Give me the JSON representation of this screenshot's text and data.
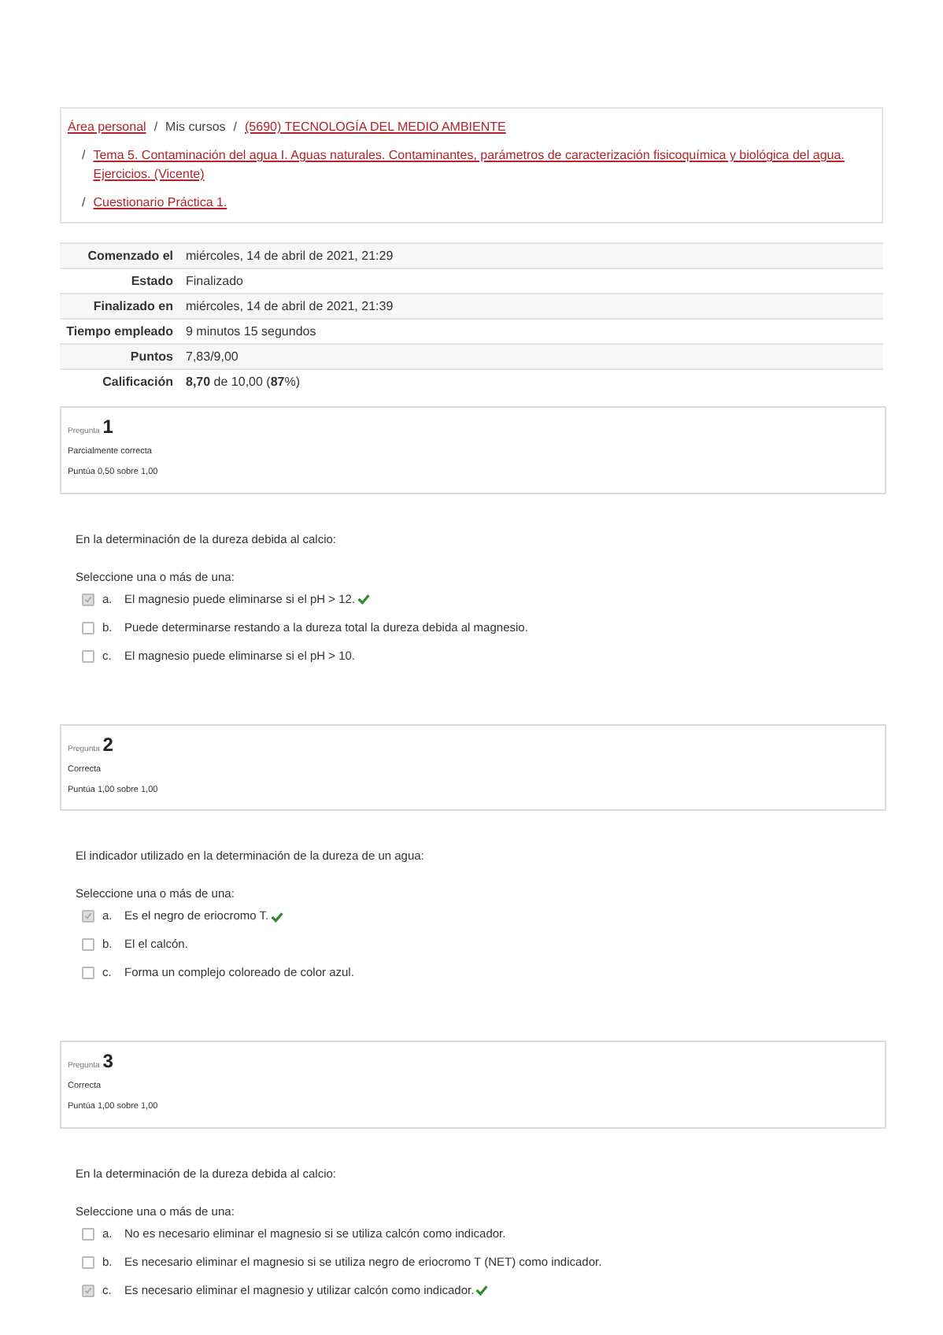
{
  "breadcrumb": {
    "lines": [
      {
        "items": [
          {
            "kind": "link",
            "text": "Área personal"
          },
          {
            "kind": "separator",
            "text": "/"
          },
          {
            "kind": "text",
            "text": "Mis cursos"
          },
          {
            "kind": "separator",
            "text": "/"
          },
          {
            "kind": "link",
            "text": "(5690) TECNOLOGÍA DEL MEDIO AMBIENTE"
          }
        ]
      },
      {
        "items": [
          {
            "kind": "separator",
            "text": "/"
          },
          {
            "kind": "link",
            "text": "Tema 5. Contaminación del agua I. Aguas naturales. Contaminantes, parámetros de caracterización fisicoquímica y biológica del agua. Ejercicios. (Vicente)"
          }
        ]
      },
      {
        "items": [
          {
            "kind": "separator",
            "text": "/"
          },
          {
            "kind": "link",
            "text": "Cuestionario Práctica 1."
          }
        ]
      }
    ]
  },
  "summary": [
    {
      "label": "Comenzado el",
      "value": "miércoles, 14 de abril de 2021, 21:29"
    },
    {
      "label": "Estado",
      "value": "Finalizado"
    },
    {
      "label": "Finalizado en",
      "value": "miércoles, 14 de abril de 2021, 21:39"
    },
    {
      "label": "Tiempo empleado",
      "value": "9 minutos 15 segundos"
    },
    {
      "label": "Puntos",
      "value": "7,83/9,00"
    },
    {
      "label": "Calificación",
      "value": "**8,70** de 10,00 (**87**%)"
    }
  ],
  "questions": [
    {
      "prefix": "Pregunta",
      "number": "1",
      "status": "Parcialmente correcta",
      "score": "Puntúa 0,50 sobre 1,00",
      "text": "En la determinación de la dureza debida al calcio:",
      "prompt": "Seleccione una o más de una:",
      "options": [
        {
          "letter": "a.",
          "text": "El magnesio puede eliminarse si el pH > 12.",
          "checked": true,
          "correct": true
        },
        {
          "letter": "b.",
          "text": "Puede determinarse restando a la dureza total la dureza debida al magnesio.",
          "checked": false,
          "correct": false
        },
        {
          "letter": "c.",
          "text": "El magnesio puede eliminarse si el pH > 10.",
          "checked": false,
          "correct": false
        }
      ]
    },
    {
      "prefix": "Pregunta",
      "number": "2",
      "status": "Correcta",
      "score": "Puntúa 1,00 sobre 1,00",
      "text": "El indicador utilizado en la determinación de la dureza de un agua:",
      "prompt": "Seleccione una o más de una:",
      "options": [
        {
          "letter": "a.",
          "text": "Es el negro de eriocromo T.",
          "checked": true,
          "correct": true
        },
        {
          "letter": "b.",
          "text": "El el calcón.",
          "checked": false,
          "correct": false
        },
        {
          "letter": "c.",
          "text": "Forma un complejo coloreado de color azul.",
          "checked": false,
          "correct": false
        }
      ]
    },
    {
      "prefix": "Pregunta",
      "number": "3",
      "status": "Correcta",
      "score": "Puntúa 1,00 sobre 1,00",
      "text": "En la determinación de la dureza debida al calcio:",
      "prompt": "Seleccione una o más de una:",
      "options": [
        {
          "letter": "a.",
          "text": "No es necesario eliminar el magnesio si se utiliza calcón como indicador.",
          "checked": false,
          "correct": false
        },
        {
          "letter": "b.",
          "text": "Es necesario eliminar el magnesio si se utiliza negro de eriocromo T (NET) como indicador.",
          "checked": false,
          "correct": false
        },
        {
          "letter": "c.",
          "text": "Es necesario eliminar el magnesio y utilizar calcón como indicador.",
          "checked": true,
          "correct": true
        }
      ]
    }
  ]
}
